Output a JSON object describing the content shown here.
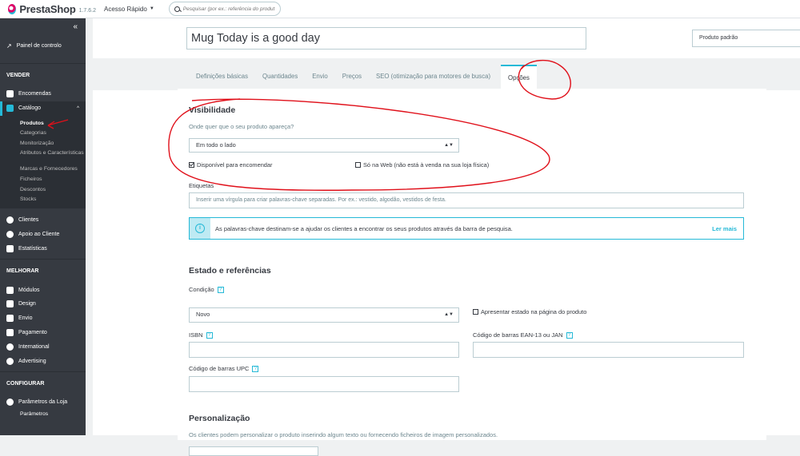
{
  "topbar": {
    "logo": "PrestaShop",
    "version": "1.7.6.2",
    "quick_access": "Acesso Rápido",
    "search_placeholder": "Pesquisar (por ex.: referência do produt"
  },
  "sidebar": {
    "dashboard": "Painel de controlo",
    "sections": {
      "sell": "VENDER",
      "improve": "MELHORAR",
      "configure": "CONFIGURAR"
    },
    "sell_items": {
      "orders": "Encomendas",
      "catalog": "Catálogo"
    },
    "catalog_sub": [
      "Produtos",
      "Categorias",
      "Monitorização",
      "Atributos e Características",
      "Marcas e Fornecedores",
      "Ficheiros",
      "Descontos",
      "Stocks"
    ],
    "sell_items_after": [
      "Clientes",
      "Apoio ao Cliente",
      "Estatísticas"
    ],
    "improve_items": [
      "Módulos",
      "Design",
      "Envio",
      "Pagamento",
      "International",
      "Advertising"
    ],
    "configure_items": [
      "Parâmetros da Loja",
      "Parâmetros"
    ]
  },
  "product": {
    "name": "Mug Today is a good day",
    "type": "Produto padrão"
  },
  "tabs": [
    "Definições básicas",
    "Quantidades",
    "Envio",
    "Preços",
    "SEO (otimização para motores de busca)",
    "Opções"
  ],
  "visibility": {
    "title": "Visibilidade",
    "help": "Onde quer que o seu produto apareça?",
    "value": "Em todo o lado",
    "available_for_order": "Disponível para encomendar",
    "online_only": "Só na Web (não está à venda na sua loja física)"
  },
  "tags": {
    "label": "Etiquetas",
    "placeholder": "Inserir uma vírgula para criar palavras-chave separadas. Por ex.: vestido, algodão, vestidos de festa.",
    "alert_text": "As palavras-chave destinam-se a ajudar os clientes a encontrar os seus produtos através da barra de pesquisa.",
    "alert_link": "Ler mais"
  },
  "state": {
    "title": "Estado e referências",
    "condition_label": "Condição",
    "condition_value": "Novo",
    "show_condition": "Apresentar estado na página do produto",
    "isbn_label": "ISBN",
    "ean_label": "Código de barras EAN-13 ou JAN",
    "upc_label": "Código de barras UPC",
    "help_mark": "?"
  },
  "customization": {
    "title": "Personalização",
    "help": "Os clientes podem personalizar o produto inserindo algum texto ou fornecendo ficheiros de imagem personalizados."
  },
  "colors": {
    "accent": "#25b9d7",
    "sidebar": "#363a41",
    "annotation": "#e0101a"
  }
}
